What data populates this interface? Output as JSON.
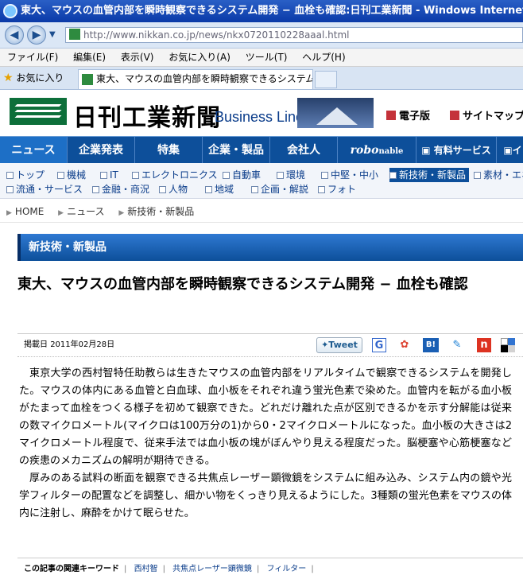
{
  "window": {
    "title": "東大、マウスの血管内部を瞬時観察できるシステム開発 − 血栓も確認:日刊工業新聞 - Windows Internet Explorer"
  },
  "browser": {
    "url": "http://www.nikkan.co.jp/news/nkx0720110228aaal.html",
    "menu": [
      "ファイル(F)",
      "編集(E)",
      "表示(V)",
      "お気に入り(A)",
      "ツール(T)",
      "ヘルプ(H)"
    ],
    "favorites_label": "お気に入り",
    "tab_title": "東大、マウスの血管内部を瞬時観察できるシステム開..."
  },
  "site": {
    "logo_text": "日刊工業新聞",
    "tagline": "Business Line",
    "header_links": [
      "電子版",
      "サイトマップ"
    ]
  },
  "gnav": [
    {
      "label": "ニュース",
      "active": true
    },
    {
      "label": "企業発表"
    },
    {
      "label": "特集"
    },
    {
      "label": "企業・製品"
    },
    {
      "label": "会社人"
    },
    {
      "label": "robo",
      "suffix": "nable"
    },
    {
      "label": "有料サービス"
    },
    {
      "label": "イ"
    }
  ],
  "subnav_row1": [
    "トップ",
    "機械",
    "IT",
    "エレクトロニクス",
    "自動車",
    "環境",
    "中堅・中小",
    "新技術・新製品",
    "素材・エネ"
  ],
  "subnav_row2": [
    "流通・サービス",
    "金融・商況",
    "人物",
    "地域",
    "企画・解説",
    "フォト"
  ],
  "subnav_active": "新技術・新製品",
  "breadcrumb": [
    "HOME",
    "ニュース",
    "新技術・新製品"
  ],
  "category": "新技術・新製品",
  "article": {
    "headline": "東大、マウスの血管内部を瞬時観察できるシステム開発 − 血栓も確認",
    "date_label": "掲載日",
    "date": "2011年02月28日",
    "paragraphs": [
      "東京大学の西村智特任助教らは生きたマウスの血管内部をリアルタイムで観察できるシステムを開発した。マウスの体内にある血管と白血球、血小板をそれぞれ違う蛍光色素で染めた。血管内を転がる血小板がたまって血栓をつくる様子を初めて観察できた。どれだけ離れた点が区別できるかを示す分解能は従来の数マイクロメートル(マイクロは100万分の1)から0・2マイクロメートルになった。血小板の大きさは2マイクロメートル程度で、従来手法では血小板の塊がぼんやり見える程度だった。脳梗塞や心筋梗塞などの疾患のメカニズムの解明が期待できる。",
      "厚みのある試料の断面を観察できる共焦点レーザー顕微鏡をシステムに組み込み、システム内の鏡や光学フィルターの配置などを調整し、細かい物をくっきり見えるようにした。3種類の蛍光色素をマウスの体内に注射し、麻酔をかけて眠らせた。"
    ],
    "keywords_label": "この記事の関連キーワード",
    "keywords": [
      "西村智",
      "共焦点レーザー顕微鏡",
      "フィルター"
    ]
  },
  "share": {
    "tweet_label": "Tweet",
    "icons": [
      "G",
      "B!",
      "n"
    ]
  },
  "colors": {
    "nav": "#0d4f9a",
    "title_bar": "#0a3aa8",
    "logo_green": "#0d6f3a"
  }
}
